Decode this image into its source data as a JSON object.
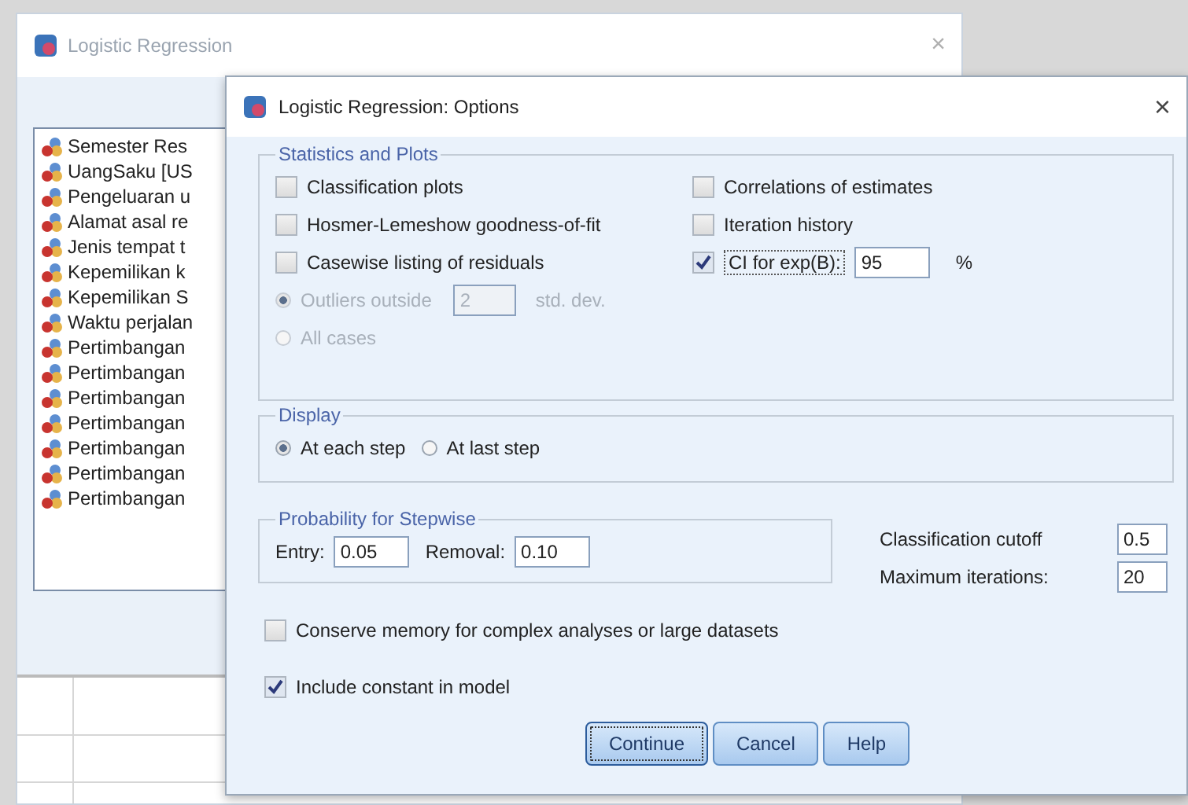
{
  "background_window": {
    "title": "Logistic Regression",
    "close": "×",
    "variables": [
      "Semester Res",
      "UangSaku [US",
      "Pengeluaran u",
      "Alamat asal re",
      "Jenis tempat t",
      "Kepemilikan k",
      "Kepemilikan S",
      "Waktu perjalan",
      "Pertimbangan",
      "Pertimbangan",
      "Pertimbangan",
      "Pertimbangan",
      "Pertimbangan",
      "Pertimbangan",
      "Pertimbangan"
    ]
  },
  "dialog": {
    "title": "Logistic Regression: Options",
    "close": "×",
    "statistics_and_plots": {
      "title": "Statistics and Plots",
      "left": [
        {
          "label": "Classification plots",
          "checked": false
        },
        {
          "label": "Hosmer-Lemeshow goodness-of-fit",
          "checked": false
        },
        {
          "label": "Casewise listing of residuals",
          "checked": false
        }
      ],
      "residual_options": {
        "disabled": true,
        "outliers": {
          "label": "Outliers outside",
          "selected": true,
          "value": "2",
          "unit": "std. dev."
        },
        "all_cases": {
          "label": "All cases",
          "selected": false
        }
      },
      "right": [
        {
          "label": "Correlations of estimates",
          "checked": false
        },
        {
          "label": "Iteration history",
          "checked": false
        },
        {
          "label": "CI for exp(B):",
          "checked": true,
          "value": "95",
          "unit": "%"
        }
      ]
    },
    "display": {
      "title": "Display",
      "options": [
        {
          "label": "At each step",
          "selected": true
        },
        {
          "label": "At last step",
          "selected": false
        }
      ]
    },
    "probability": {
      "title": "Probability for Stepwise",
      "entry_label": "Entry:",
      "entry": "0.05",
      "removal_label": "Removal:",
      "removal": "0.10"
    },
    "classification_cutoff": {
      "label": "Classification cutoff",
      "value": "0.5"
    },
    "maximum_iterations": {
      "label": "Maximum iterations:",
      "value": "20"
    },
    "conserve_memory": {
      "label": "Conserve memory for complex analyses or large datasets",
      "checked": false
    },
    "include_constant": {
      "label": "Include constant in model",
      "checked": true
    },
    "buttons": [
      "Continue",
      "Cancel",
      "Help"
    ]
  }
}
